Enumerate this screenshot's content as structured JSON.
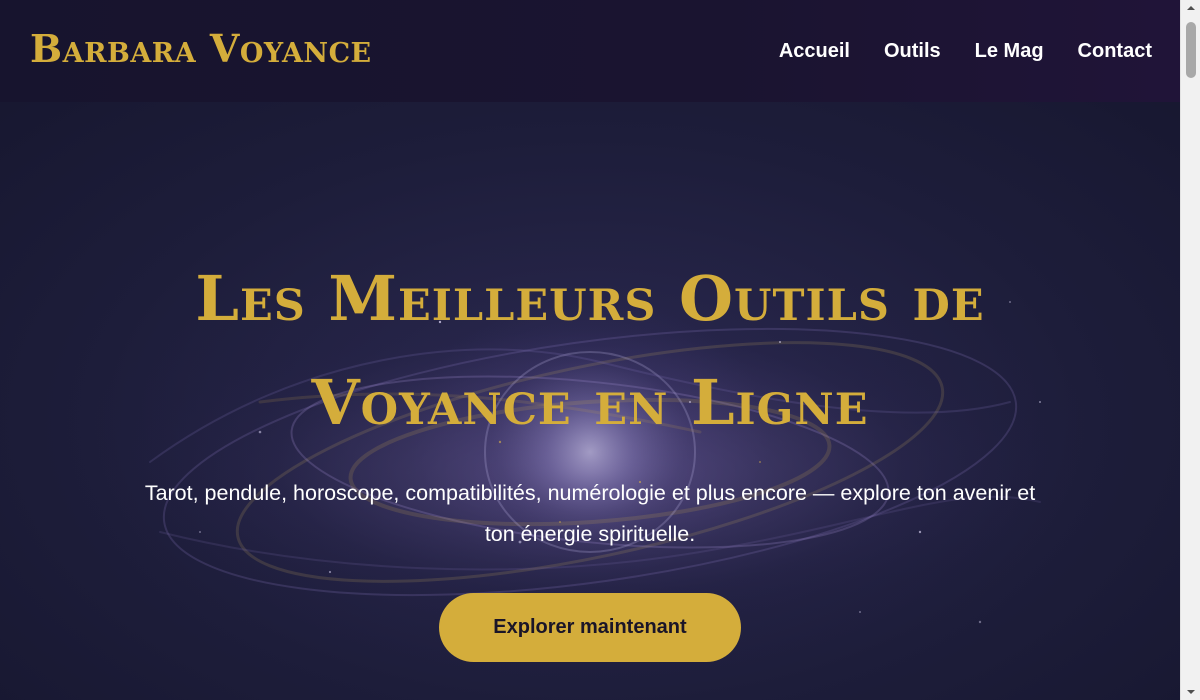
{
  "header": {
    "brand": "Barbara Voyance",
    "nav": [
      {
        "label": "Accueil"
      },
      {
        "label": "Outils"
      },
      {
        "label": "Le Mag"
      },
      {
        "label": "Contact"
      }
    ]
  },
  "hero": {
    "title_line1": "Les Meilleurs Outils de",
    "title_line2": "Voyance en Ligne",
    "subtitle_line1": "Tarot, pendule, horoscope, compatibilités, numérologie et plus encore — explore ton avenir et",
    "subtitle_line2": "ton énergie spirituelle.",
    "cta_label": "Explorer maintenant",
    "background_icon": "galaxy-image"
  },
  "colors": {
    "accent_gold": "#d4ad3b",
    "header_bg": "#17142e",
    "hero_bg": "#1d1d3a",
    "text_light": "#ffffff",
    "button_text": "#1a1528"
  },
  "scrollbar": {
    "up_icon": "chevron-up-icon",
    "down_icon": "chevron-down-icon"
  }
}
